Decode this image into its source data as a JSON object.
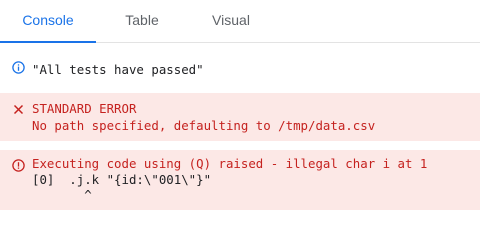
{
  "tabs": {
    "console": "Console",
    "table": "Table",
    "visual": "Visual",
    "active": "Console"
  },
  "messages": {
    "info": {
      "icon": "info-icon",
      "text": "\"All tests have passed\""
    },
    "stderr": {
      "icon": "close-icon",
      "title": "STANDARD ERROR",
      "detail": "No path specified, defaulting to /tmp/data.csv"
    },
    "error": {
      "icon": "error-icon",
      "title": "Executing code using (Q) raised - illegal char i at 1",
      "code": "[0]  .j.k \"{id:\\\"001\\\"}\"",
      "caret": "       ^"
    }
  },
  "colors": {
    "accent": "#1a73e8",
    "error_text": "#c5221f",
    "error_background": "#fce8e6",
    "tab_text": "#5f6368"
  }
}
